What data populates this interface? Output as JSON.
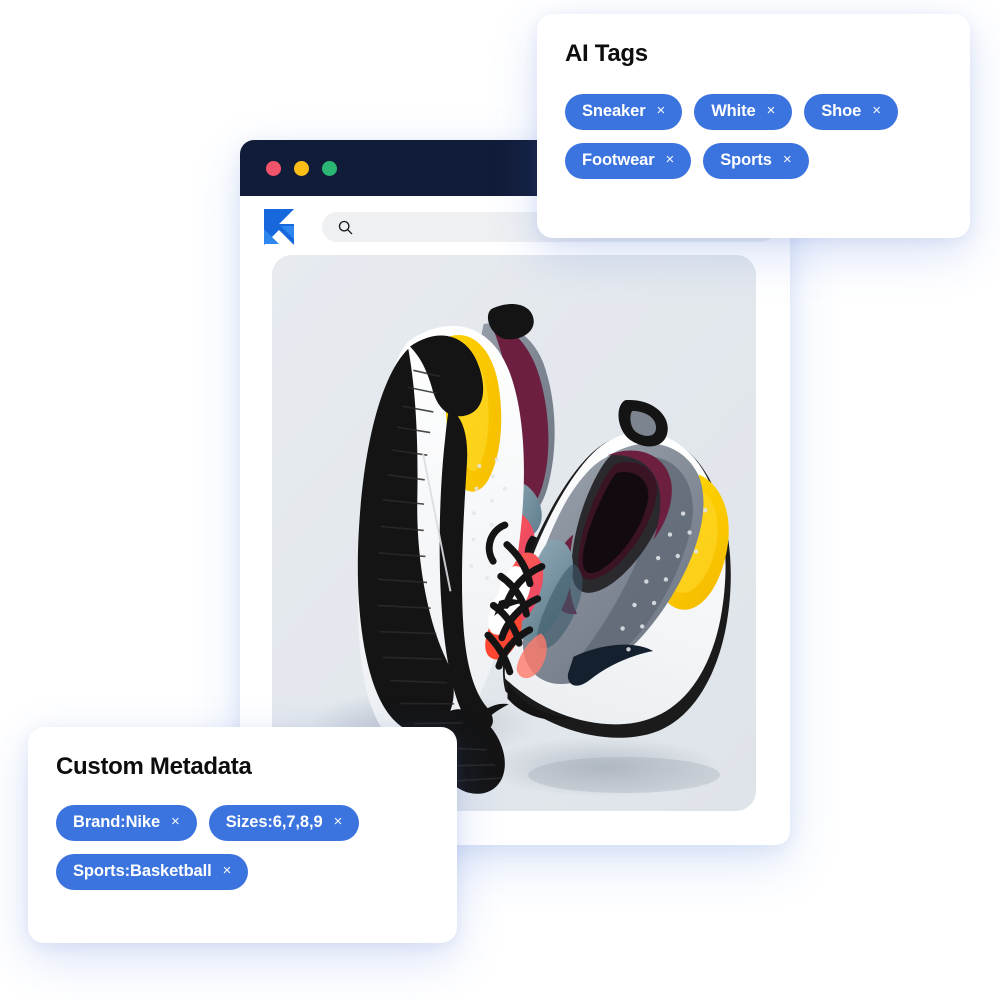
{
  "window": {
    "titlebar_dots": [
      {
        "name": "close-dot",
        "color": "#f2546b"
      },
      {
        "name": "minimize-dot",
        "color": "#fbbe15"
      },
      {
        "name": "maximize-dot",
        "color": "#2bb673"
      }
    ],
    "logo_name": "imagekit-logo",
    "logo_color": "#1668dc",
    "search": {
      "icon": "search-icon",
      "value": "",
      "placeholder": ""
    }
  },
  "media": {
    "alt": "Pair of Nike Air Max Dia sneakers, white with yellow and grey accents",
    "background_color": "#e2e7ec"
  },
  "ai_tags_card": {
    "title": "AI Tags",
    "accent": "#3b74de",
    "rows": [
      [
        "Sneaker",
        "White",
        "Shoe"
      ],
      [
        "Footwear",
        "Sports"
      ]
    ],
    "remove_glyph": "×"
  },
  "custom_metadata_card": {
    "title": "Custom Metadata",
    "accent": "#3b74de",
    "rows": [
      [
        "Brand:Nike",
        "Sizes:6,7,8,9"
      ],
      [
        "Sports:Basketball"
      ]
    ],
    "remove_glyph": "×"
  }
}
